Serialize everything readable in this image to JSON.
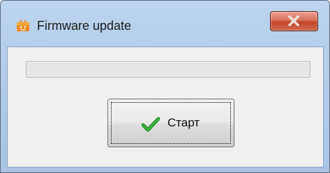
{
  "window": {
    "title": "Firmware update",
    "title_icon": "app-icon",
    "close_label": "close-icon"
  },
  "progress": {
    "value": 0,
    "max": 100
  },
  "start_button": {
    "label": "Старт",
    "icon": "checkmark-icon"
  },
  "colors": {
    "titlebar": "#b2cbe8",
    "close_button": "#c2442b",
    "client_background": "#f0f0f0",
    "checkmark": "#2c9a2c"
  }
}
